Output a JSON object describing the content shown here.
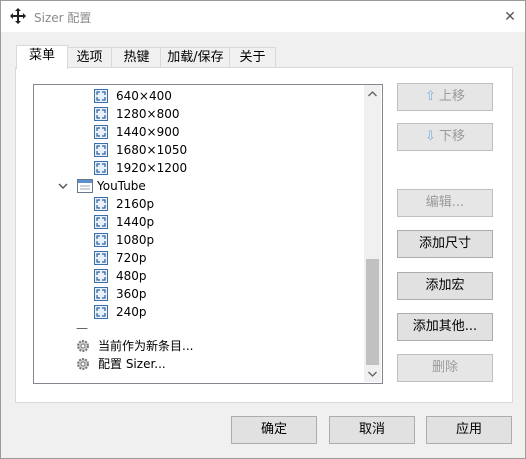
{
  "window": {
    "title": "Sizer 配置",
    "close_glyph": "✕"
  },
  "tabs": [
    {
      "label": "菜单",
      "active": true
    },
    {
      "label": "选项",
      "active": false
    },
    {
      "label": "热键",
      "active": false
    },
    {
      "label": "加载/保存",
      "active": false
    },
    {
      "label": "关于",
      "active": false
    }
  ],
  "tree": {
    "items": [
      {
        "label": "640×400",
        "icon": "resize-icon"
      },
      {
        "label": "1280×800",
        "icon": "resize-icon"
      },
      {
        "label": "1440×900",
        "icon": "resize-icon"
      },
      {
        "label": "1680×1050",
        "icon": "resize-icon"
      },
      {
        "label": "1920×1200",
        "icon": "resize-icon"
      },
      {
        "label": "YouTube",
        "icon": "submenu-icon",
        "expanded": true
      },
      {
        "label": "2160p",
        "icon": "resize-icon"
      },
      {
        "label": "1440p",
        "icon": "resize-icon"
      },
      {
        "label": "1080p",
        "icon": "resize-icon"
      },
      {
        "label": "720p",
        "icon": "resize-icon"
      },
      {
        "label": "480p",
        "icon": "resize-icon"
      },
      {
        "label": "360p",
        "icon": "resize-icon"
      },
      {
        "label": "240p",
        "icon": "resize-icon"
      },
      {
        "label": "—",
        "icon": "separator"
      },
      {
        "label": "当前作为新条目...",
        "icon": "gear-icon"
      },
      {
        "label": "配置 Sizer...",
        "icon": "gear-icon"
      }
    ]
  },
  "side_buttons": {
    "move_up": "上移",
    "move_down": "下移",
    "edit": "编辑...",
    "add_size": "添加尺寸",
    "add_macro": "添加宏",
    "add_other": "添加其他...",
    "delete": "删除"
  },
  "footer": {
    "ok": "确定",
    "cancel": "取消",
    "apply": "应用"
  },
  "colors": {
    "accent_arrow": "#7fb0e0",
    "disabled_text": "#9b9b9b",
    "icon_border": "#3c6fa8"
  }
}
